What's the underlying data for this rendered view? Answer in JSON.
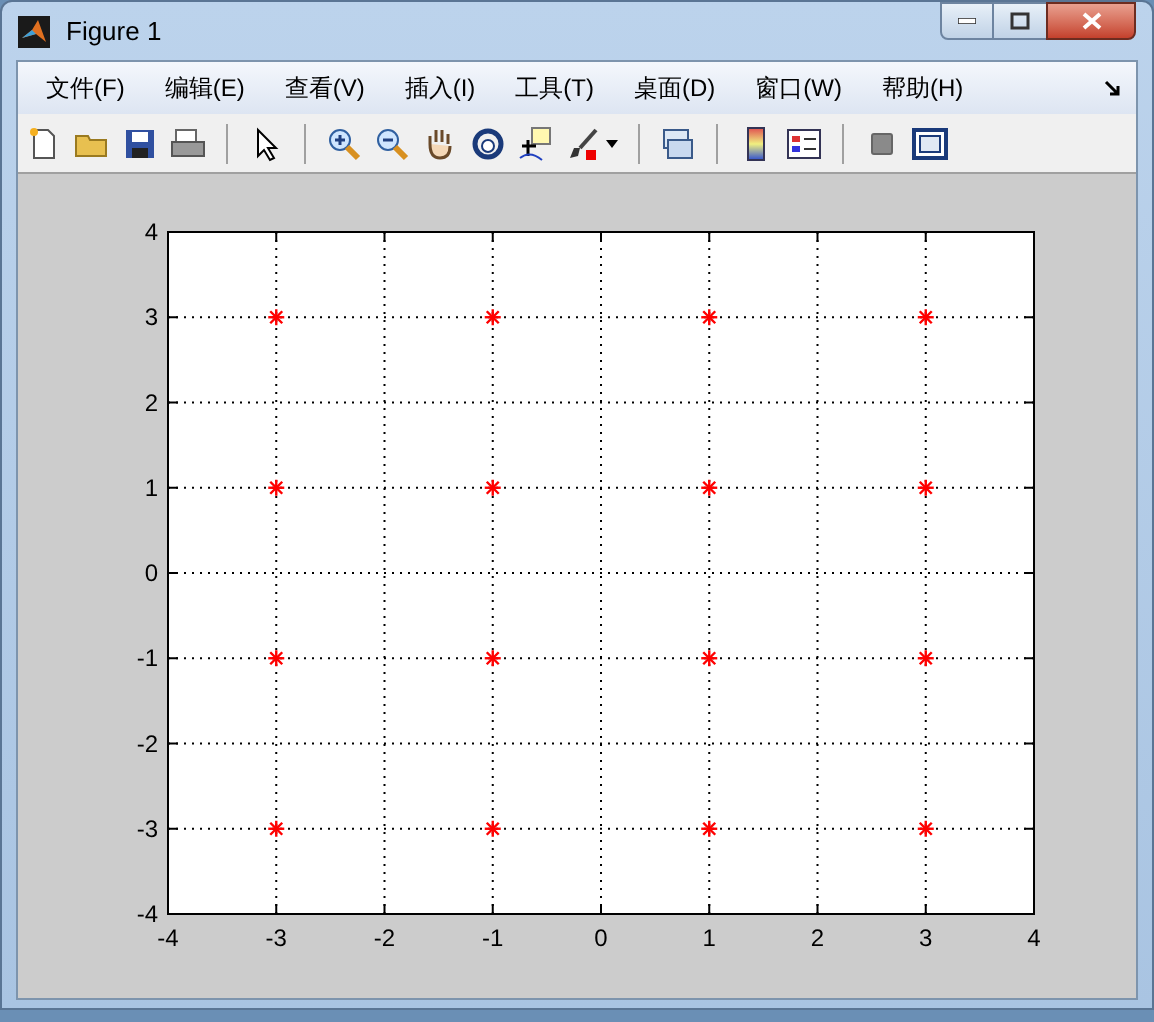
{
  "window": {
    "title": "Figure 1"
  },
  "menu": [
    "文件(F)",
    "编辑(E)",
    "查看(V)",
    "插入(I)",
    "工具(T)",
    "桌面(D)",
    "窗口(W)",
    "帮助(H)"
  ],
  "plot": {
    "chart_data": {
      "type": "scatter",
      "grid": true,
      "xlim": [
        -4,
        4
      ],
      "ylim": [
        -4,
        4
      ],
      "xticks": [
        -4,
        -3,
        -2,
        -1,
        0,
        1,
        2,
        3,
        4
      ],
      "yticks": [
        -4,
        -3,
        -2,
        -1,
        0,
        1,
        2,
        3,
        4
      ],
      "x": [
        -3,
        -1,
        1,
        3,
        -3,
        -1,
        1,
        3,
        -3,
        -1,
        1,
        3,
        -3,
        -1,
        1,
        3
      ],
      "series": [
        {
          "color": "#ff0000",
          "values": [
            3,
            3,
            3,
            3,
            1,
            1,
            1,
            1,
            -1,
            -1,
            -1,
            -1,
            -3,
            -3,
            -3,
            -3
          ]
        }
      ]
    }
  }
}
